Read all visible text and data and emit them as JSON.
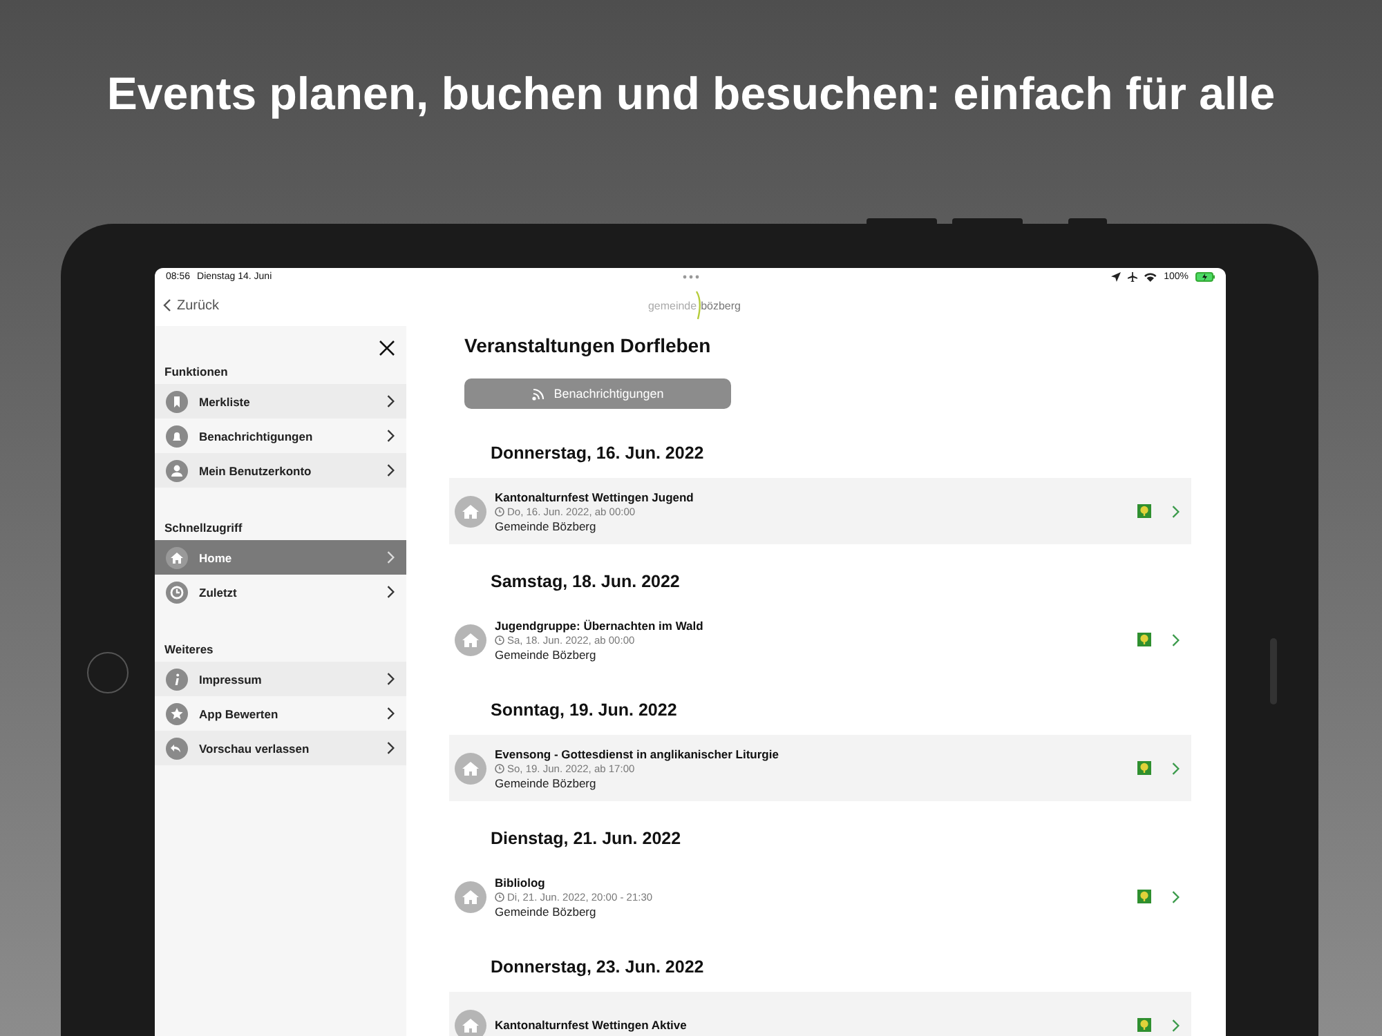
{
  "headline": "Events planen, buchen und besuchen: einfach für alle",
  "status_bar": {
    "time": "08:56",
    "date": "Dienstag 14. Juni",
    "battery": "100%"
  },
  "nav": {
    "back": "Zurück",
    "logo_left": "gemeinde",
    "logo_right": "bözberg"
  },
  "sidebar": {
    "sections": [
      {
        "title": "Funktionen",
        "items": [
          {
            "label": "Merkliste",
            "selected": false
          },
          {
            "label": "Benachrichtigungen",
            "selected": false
          },
          {
            "label": "Mein Benutzerkonto",
            "selected": false
          }
        ]
      },
      {
        "title": "Schnellzugriff",
        "items": [
          {
            "label": "Home",
            "selected": true
          },
          {
            "label": "Zuletzt",
            "selected": false
          }
        ]
      },
      {
        "title": "Weiteres",
        "items": [
          {
            "label": "Impressum",
            "selected": false
          },
          {
            "label": "App Bewerten",
            "selected": false
          },
          {
            "label": "Vorschau verlassen",
            "selected": false
          }
        ]
      }
    ]
  },
  "main": {
    "title": "Veranstaltungen Dorfleben",
    "notify_button": "Benachrichtigungen",
    "days": [
      {
        "date": "Donnerstag, 16. Jun. 2022",
        "events": [
          {
            "title": "Kantonalturnfest Wettingen Jugend",
            "time": "Do, 16. Jun. 2022, ab 00:00",
            "location": "Gemeinde Bözberg"
          }
        ]
      },
      {
        "date": "Samstag, 18. Jun. 2022",
        "events": [
          {
            "title": "Jugendgruppe: Übernachten im Wald",
            "time": "Sa, 18. Jun. 2022, ab 00:00",
            "location": "Gemeinde Bözberg"
          }
        ]
      },
      {
        "date": "Sonntag, 19. Jun. 2022",
        "events": [
          {
            "title": "Evensong - Gottesdienst in anglikanischer Liturgie",
            "time": "So, 19. Jun. 2022, ab 17:00",
            "location": "Gemeinde Bözberg"
          }
        ]
      },
      {
        "date": "Dienstag, 21. Jun. 2022",
        "events": [
          {
            "title": "Bibliolog",
            "time": "Di, 21. Jun. 2022, 20:00 - 21:30",
            "location": "Gemeinde Bözberg"
          }
        ]
      },
      {
        "date": "Donnerstag, 23. Jun. 2022",
        "events": [
          {
            "title": "Kantonalturnfest Wettingen Aktive"
          }
        ]
      }
    ]
  }
}
